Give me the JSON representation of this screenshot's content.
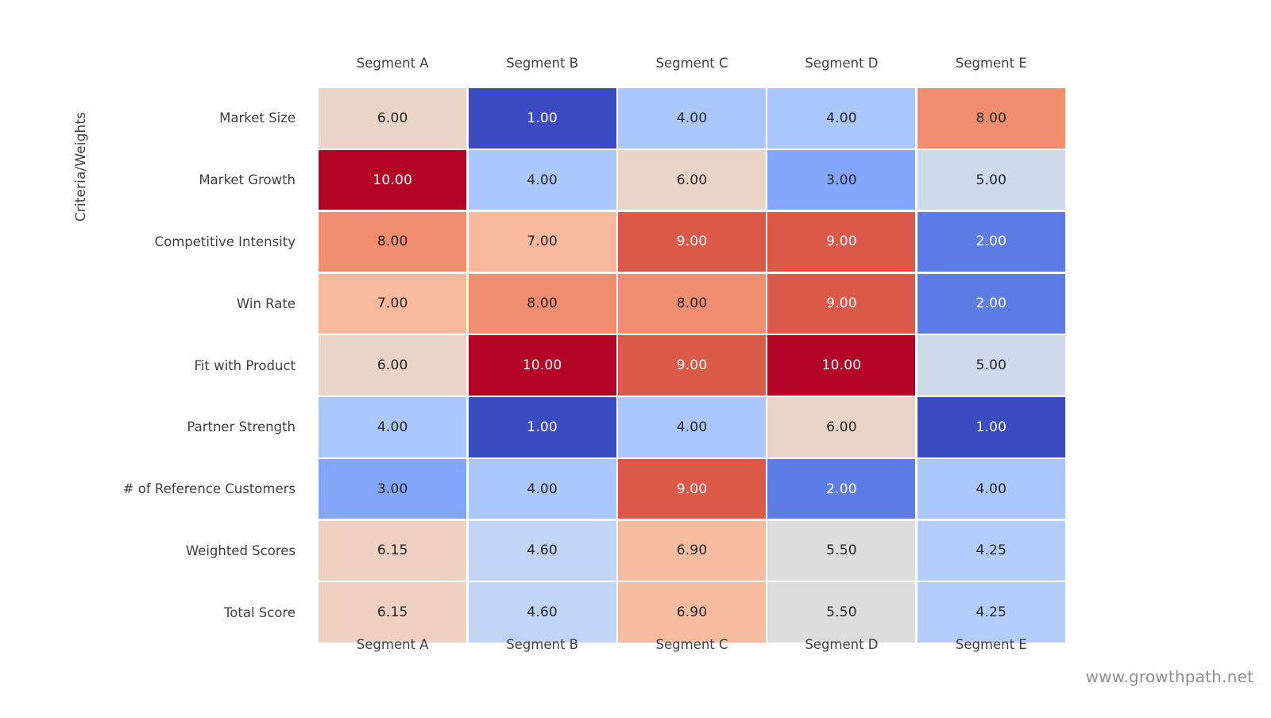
{
  "figure": {
    "y_axis_title": "Criteria/Weights",
    "watermark": "www.growthpath.net"
  },
  "chart_data": {
    "type": "heatmap",
    "title": "",
    "xlabel": "",
    "ylabel": "Criteria/Weights",
    "colormap": "coolwarm",
    "value_format": "0.00",
    "vmin": 1.0,
    "vmax": 10.0,
    "vcenter": 5.0,
    "grid": false,
    "legend": "none",
    "xtick_labels_top": [
      "Segment A",
      "Segment B",
      "Segment C",
      "Segment D",
      "Segment E"
    ],
    "xtick_labels_bottom": [
      "Segment A",
      "Segment B",
      "Segment C",
      "Segment D",
      "Segment E"
    ],
    "categories": [
      "Segment A",
      "Segment B",
      "Segment C",
      "Segment D",
      "Segment E"
    ],
    "row_labels": [
      "Market Size",
      "Market Growth",
      "Competitive Intensity",
      "Win Rate",
      "Fit with Product",
      "Partner Strength",
      "# of Reference Customers",
      "Weighted Scores",
      "Total Score"
    ],
    "rows": [
      {
        "label": "Market Size",
        "values": [
          6.0,
          1.0,
          4.0,
          4.0,
          8.0
        ]
      },
      {
        "label": "Market Growth",
        "values": [
          10.0,
          4.0,
          6.0,
          3.0,
          5.0
        ]
      },
      {
        "label": "Competitive Intensity",
        "values": [
          8.0,
          7.0,
          9.0,
          9.0,
          2.0
        ]
      },
      {
        "label": "Win Rate",
        "values": [
          7.0,
          8.0,
          8.0,
          9.0,
          2.0
        ]
      },
      {
        "label": "Fit with Product",
        "values": [
          6.0,
          10.0,
          9.0,
          10.0,
          5.0
        ]
      },
      {
        "label": "Partner Strength",
        "values": [
          4.0,
          1.0,
          4.0,
          6.0,
          1.0
        ]
      },
      {
        "label": "# of Reference Customers",
        "values": [
          3.0,
          4.0,
          9.0,
          2.0,
          4.0
        ]
      },
      {
        "label": "Weighted Scores",
        "values": [
          6.15,
          4.6,
          6.9,
          5.5,
          4.25
        ]
      },
      {
        "label": "Total Score",
        "values": [
          6.15,
          4.6,
          6.9,
          5.5,
          4.25
        ]
      }
    ],
    "palette": {
      "low": "#3b4cc0",
      "mid": "#dddddd",
      "high": "#b40426",
      "text_dark": "#262626",
      "text_light": "#ffffff"
    }
  }
}
